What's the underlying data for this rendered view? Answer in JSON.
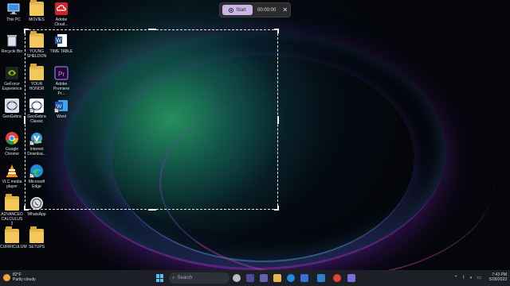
{
  "desktop": {
    "icons": [
      {
        "name": "this-pc",
        "label": "This PC"
      },
      {
        "name": "movies",
        "label": "MOVIES"
      },
      {
        "name": "adobe-cloud",
        "label": "Adobe Cloud..."
      },
      {
        "name": "recycle-bin",
        "label": "Recycle Bin"
      },
      {
        "name": "young-sheldon",
        "label": "YOUNG SHELDON"
      },
      {
        "name": "time-table",
        "label": "TIME TABLE"
      },
      {
        "name": "geforce",
        "label": "GeForce Experience"
      },
      {
        "name": "your-honor",
        "label": "YOUR HONOR"
      },
      {
        "name": "premiere",
        "label": "Adobe Premiere Pr..."
      },
      {
        "name": "geogebra-1",
        "label": "GeoGebra"
      },
      {
        "name": "geogebra-classic",
        "label": "GeoGebra Classic"
      },
      {
        "name": "word",
        "label": "Word"
      },
      {
        "name": "chrome",
        "label": "Google Chrome"
      },
      {
        "name": "idm",
        "label": "Internet Downloa..."
      },
      {
        "name": "vlc",
        "label": "VLC media player"
      },
      {
        "name": "edge",
        "label": "Microsoft Edge"
      },
      {
        "name": "advanced-calculus",
        "label": "ADVANCED CALCULUS 2"
      },
      {
        "name": "whatsapp",
        "label": "WhatsApp"
      },
      {
        "name": "curriculum",
        "label": "CURRICULUM"
      },
      {
        "name": "setups",
        "label": "SETUPS"
      }
    ]
  },
  "recorder": {
    "start_label": "Start",
    "timer": "00:00:00",
    "close_glyph": "✕"
  },
  "taskbar": {
    "weather_temp": "82°F",
    "weather_desc": "Partly cloudy",
    "search_placeholder": "Search",
    "time": "7:43 PM",
    "date": "5/28/2023"
  },
  "colors": {
    "accent": "#c8b6e8",
    "taskbar": "#1c1f26",
    "folder": "#f3c85a"
  }
}
